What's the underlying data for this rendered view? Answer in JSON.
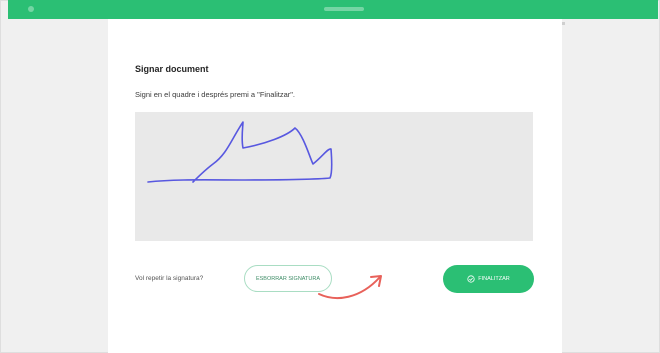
{
  "colors": {
    "brand_green": "#2bbf74",
    "signature_ink": "#5858e0",
    "annotation_arrow": "#e8615a",
    "pad_background": "#e9e9e9"
  },
  "header": {
    "heading": "Signar document",
    "instruction": "Signi en el quadre i després premi a \"Finalitzar\"."
  },
  "signature_pad": {
    "has_signature": true
  },
  "actions": {
    "repeat_prompt": "Vol repetir la signatura?",
    "clear_label": "ESBORRAR SIGNATURA",
    "finish_label": "FINALITZAR",
    "finish_icon": "check-circle-icon"
  },
  "annotation": {
    "icon": "curved-arrow-icon"
  }
}
